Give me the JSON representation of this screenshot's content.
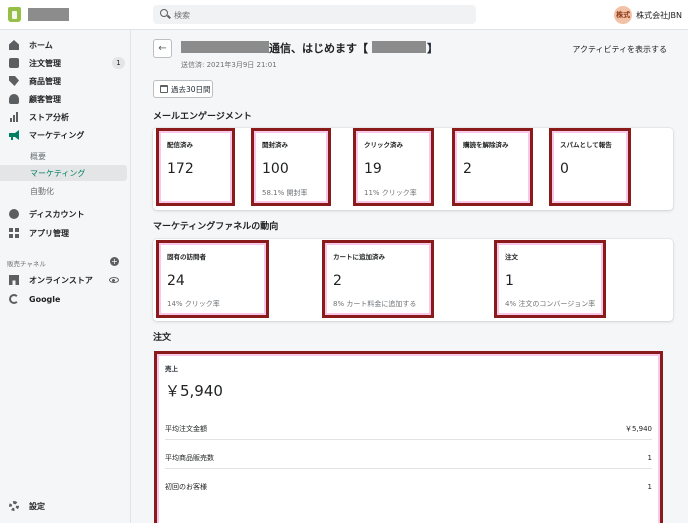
{
  "search": {
    "placeholder": "検索"
  },
  "account": {
    "avatar_text": "株式",
    "name": "株式会社JBN"
  },
  "sidebar": {
    "items": [
      {
        "label": "ホーム",
        "icon": "home-icon"
      },
      {
        "label": "注文管理",
        "icon": "order-icon",
        "badge": "1"
      },
      {
        "label": "商品管理",
        "icon": "tag-icon"
      },
      {
        "label": "顧客管理",
        "icon": "person-icon"
      },
      {
        "label": "ストア分析",
        "icon": "chart-icon"
      },
      {
        "label": "マーケティング",
        "icon": "megaphone-icon"
      }
    ],
    "sub_items": [
      "概要",
      "マーケティング",
      "自動化"
    ],
    "items2": [
      {
        "label": "ディスカウント",
        "icon": "discount-icon"
      },
      {
        "label": "アプリ管理",
        "icon": "apps-icon"
      }
    ],
    "channels_label": "販売チャネル",
    "channels": [
      {
        "label": "オンラインストア",
        "icon": "store-icon"
      },
      {
        "label": "Google",
        "icon": "google-icon"
      }
    ],
    "settings_label": "設定"
  },
  "header": {
    "title_mid": "通信、はじめます【",
    "title_end": "】",
    "sent_meta": "送信済: 2021年3月9日 21:01",
    "activity_link": "アクティビティを表示する",
    "date_range": "過去30日間"
  },
  "email_engagement": {
    "title": "メールエンゲージメント",
    "metrics": [
      {
        "label": "配信済み",
        "value": "172",
        "sub": ""
      },
      {
        "label": "開封済み",
        "value": "100",
        "sub": "58.1% 開封率"
      },
      {
        "label": "クリック済み",
        "value": "19",
        "sub": "11% クリック率"
      },
      {
        "label": "購読を解除済み",
        "value": "2",
        "sub": ""
      },
      {
        "label": "スパムとして報告",
        "value": "0",
        "sub": ""
      }
    ]
  },
  "funnel": {
    "title": "マーケティングファネルの動向",
    "metrics": [
      {
        "label": "固有の訪問者",
        "value": "24",
        "sub": "14% クリック率"
      },
      {
        "label": "カートに追加済み",
        "value": "2",
        "sub": "8% カート料金に追加する"
      },
      {
        "label": "注文",
        "value": "1",
        "sub": "4% 注文のコンバージョン率"
      }
    ]
  },
  "orders": {
    "title": "注文",
    "sales_label": "売上",
    "sales_value": "￥5,940",
    "rows": [
      {
        "label": "平均注文金額",
        "value": "￥5,940"
      },
      {
        "label": "平均商品販売数",
        "value": "1"
      },
      {
        "label": "初回のお客様",
        "value": "1"
      }
    ]
  }
}
